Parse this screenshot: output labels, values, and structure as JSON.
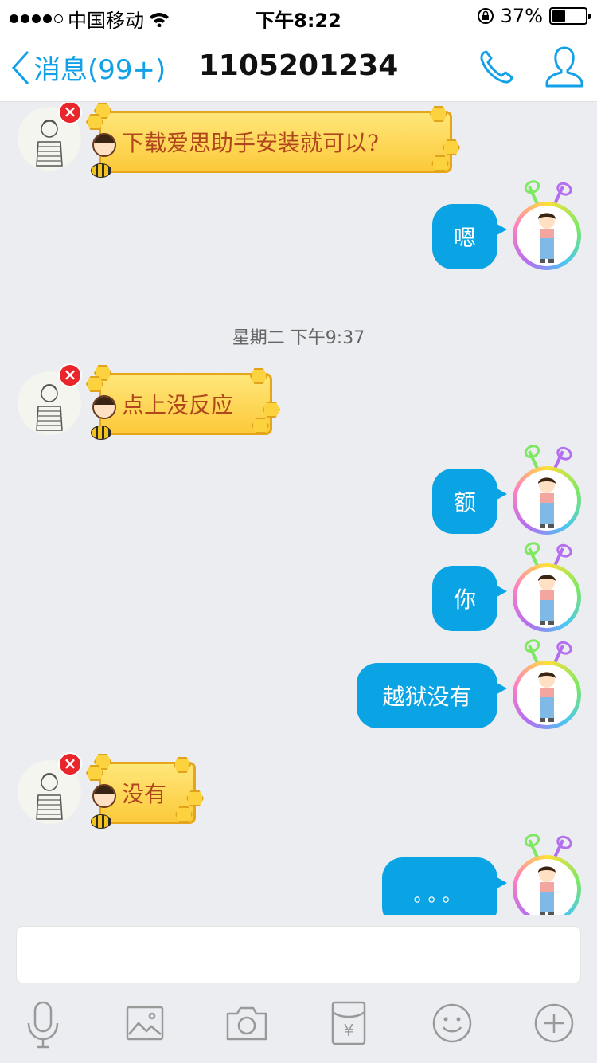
{
  "status_bar": {
    "carrier": "中国移动",
    "time": "下午8:22",
    "battery": "37%",
    "battery_level": 0.37
  },
  "nav": {
    "back_label": "消息(99+)",
    "title": "1105201234"
  },
  "messages": [
    {
      "side": "left",
      "text": "下载爱思助手安装就可以?"
    },
    {
      "side": "right",
      "text": "嗯"
    },
    {
      "side": "time",
      "text": "星期二 下午9:37"
    },
    {
      "side": "left",
      "text": "点上没反应"
    },
    {
      "side": "right",
      "text": "额"
    },
    {
      "side": "right",
      "text": "你"
    },
    {
      "side": "right",
      "text": "越狱没有"
    },
    {
      "side": "left",
      "text": "没有"
    },
    {
      "side": "right",
      "text": "。。。"
    }
  ],
  "input": {
    "placeholder": ""
  },
  "toolbar": [
    "microphone",
    "image",
    "camera",
    "red-packet",
    "emoji",
    "more"
  ],
  "colors": {
    "accent": "#12a1e8",
    "bubble": "#0aa3e3",
    "badge": "#e8262b"
  }
}
